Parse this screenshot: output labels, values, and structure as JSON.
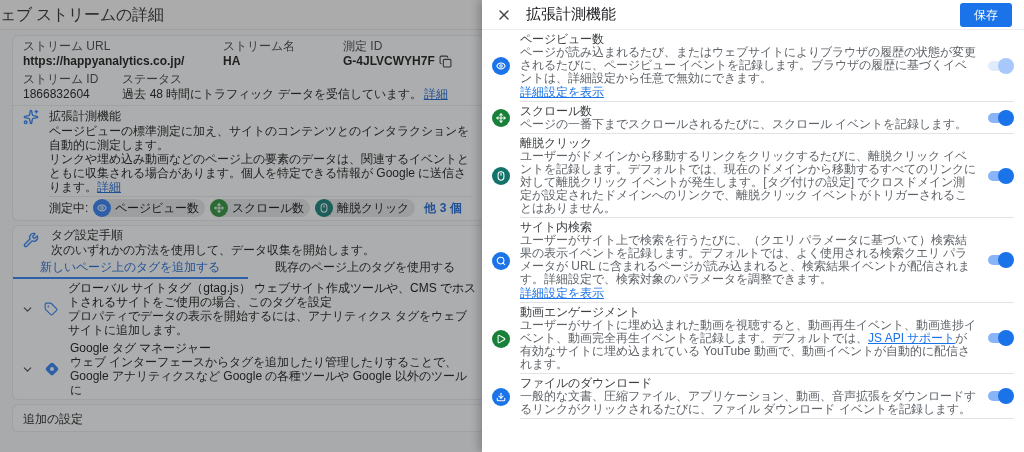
{
  "page": {
    "title": "ェブ ストリームの詳細"
  },
  "stream": {
    "fields": [
      {
        "label": "ストリーム URL",
        "value": "https://happyanalytics.co.jp/"
      },
      {
        "label": "ストリーム名",
        "value": "HA"
      },
      {
        "label": "測定 ID",
        "value": "G-4JLVCWYH7F"
      }
    ],
    "stream_id": {
      "label": "ストリーム ID",
      "value": "1866832604"
    },
    "status": {
      "label": "ステータス",
      "value": "過去 48 時間にトラフィック データを受信しています。",
      "link": "詳細"
    }
  },
  "enhanced": {
    "title": "拡張計測機能",
    "lines": [
      "ページビューの標準測定に加え、サイトのコンテンツとのインタラクションを自動的に測定します。",
      "リンクや埋め込み動画などのページ上の要素のデータは、関連するイベントとともに収集される場合があります。個人を特定できる情報が Google に送信さ"
    ],
    "tail": "ります。",
    "link": "詳細",
    "measuring_label": "測定中:",
    "chips": [
      {
        "kind": "pageview",
        "label": "ページビュー数"
      },
      {
        "kind": "scroll",
        "label": "スクロール数"
      },
      {
        "kind": "outbound",
        "label": "離脱クリック"
      }
    ],
    "more": "他 3 個"
  },
  "tagging": {
    "title": "タグ設定手順",
    "subtitle": "次のいずれかの方法を使用して、データ収集を開始します。",
    "tabs": [
      {
        "label": "新しいページ上のタグを追加する",
        "selected": true
      },
      {
        "label": "既存のページ上のタグを使用する",
        "selected": false
      }
    ],
    "options": [
      {
        "kind": "gtag",
        "title": "グローバル サイトタグ（gtag.js） ウェブサイト作成ツールや、CMS でホストされるサイトをご使用の場合、このタグを設定",
        "subtitle": "プロパティでデータの表示を開始するには、アナリティクス タグをウェブサイトに追加します。"
      },
      {
        "kind": "gtm",
        "title": "Google タグ マネージャー",
        "subtitle": "ウェブ インターフェースからタグを追加したり管理したりすることで、Google アナリティクスなど Google の各種ツールや Google 以外のツールに"
      }
    ]
  },
  "additional": {
    "title": "追加の設定"
  },
  "panel": {
    "title": "拡張計測機能",
    "save": "保存",
    "items": [
      {
        "kind": "pageview",
        "title": "ページビュー数",
        "description": [
          {
            "kind": "text",
            "text": "ページが読み込まれるたび、またはウェブサイトによりブラウザの履歴の状態が変更されるたびに、ページビュー イベントを記録します。ブラウザの履歴に基づくイベントは、詳細設定から任意で無効にできます。"
          }
        ],
        "link": "詳細設定を表示",
        "on": true,
        "disabled": true
      },
      {
        "kind": "scroll",
        "title": "スクロール数",
        "description": [
          {
            "kind": "text",
            "text": "ページの一番下までスクロールされるたびに、スクロール イベントを記録します。"
          }
        ],
        "on": true,
        "disabled": false
      },
      {
        "kind": "outbound",
        "title": "離脱クリック",
        "description": [
          {
            "kind": "text",
            "text": "ユーザーがドメインから移動するリンクをクリックするたびに、離脱クリック イベントを記録します。デフォルトでは、現在のドメインから移動するすべてのリンクに対して離脱クリック イベントが発生します。[タグ付けの設定] でクロスドメイン測定が設定されたドメインへのリンクで、離脱クリック イベントがトリガーされることはありません。"
          }
        ],
        "on": true,
        "disabled": false
      },
      {
        "kind": "search",
        "title": "サイト内検索",
        "description": [
          {
            "kind": "text",
            "text": "ユーザーがサイト上で検索を行うたびに、（クエリ パラメータに基づいて）検索結果の表示イベントを記録します。デフォルトでは、よく使用される検索クエリ パラメータが URL に含まれるページが読み込まれると、検索結果イベントが配信されます。詳細設定で、検索対象のパラメータを調整できます。"
          }
        ],
        "link": "詳細設定を表示",
        "on": true,
        "disabled": false
      },
      {
        "kind": "video",
        "title": "動画エンゲージメント",
        "description": [
          {
            "kind": "text",
            "text": "ユーザーがサイトに埋め込まれた動画を視聴すると、動画再生イベント、動画進捗イベント、動画完全再生イベントを記録します。デフォルトでは、"
          },
          {
            "kind": "link",
            "text": "JS API サポート"
          },
          {
            "kind": "text",
            "text": "が有効なサイトに埋め込まれている YouTube 動画で、動画イベントが自動的に配信されます。"
          }
        ],
        "on": true,
        "disabled": false
      },
      {
        "kind": "download",
        "title": "ファイルのダウンロード",
        "description": [
          {
            "kind": "text",
            "text": "一般的な文書、圧縮ファイル、アプリケーション、動画、音声拡張をダウンロードするリンクがクリックされるたびに、ファイル ダウンロード イベントを記録します。"
          }
        ],
        "on": true,
        "disabled": false
      }
    ]
  }
}
